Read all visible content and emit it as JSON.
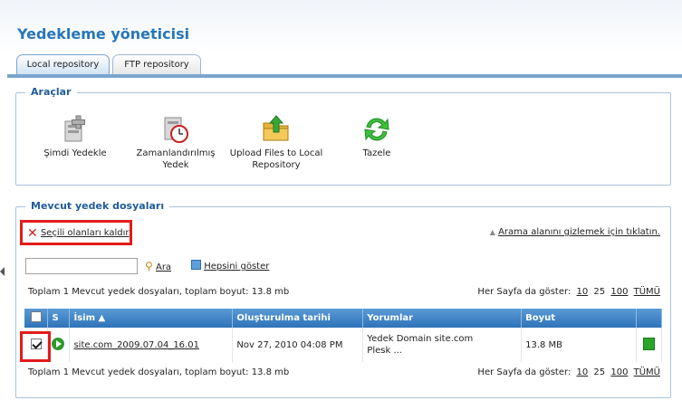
{
  "page": {
    "title": "Yedekleme yöneticisi"
  },
  "tabs": [
    {
      "label": "Local repository",
      "active": true
    },
    {
      "label": "FTP repository",
      "active": false
    }
  ],
  "tools": {
    "legend": "Araçlar",
    "items": [
      {
        "label": "Şimdi Yedekle",
        "icon": "backup-now-icon"
      },
      {
        "label": "Zamanlandırılmış Yedek",
        "icon": "scheduled-backup-icon"
      },
      {
        "label": "Upload Files to Local Repository",
        "icon": "upload-folder-icon"
      },
      {
        "label": "Tazele",
        "icon": "refresh-icon"
      }
    ]
  },
  "backups": {
    "legend": "Mevcut yedek dosyaları",
    "remove_selected": "Seçili olanları kaldır",
    "hide_search": "Arama alanını gizlemek için tıklatın.",
    "search": {
      "value": "",
      "placeholder": "",
      "search_label": "Ara",
      "show_all_label": "Hepsini göster"
    },
    "summary": "Toplam 1 Mevcut yedek dosyaları, toplam boyut: 13.8 mb",
    "per_page_label": "Her Sayfa da göster:",
    "per_page_options": [
      "10",
      "25",
      "100",
      "TÜMÜ"
    ],
    "columns": {
      "s": "S",
      "name": "İsim ▲",
      "created": "Oluşturulma tarihi",
      "comments": "Yorumlar",
      "size": "Boyut"
    },
    "rows": [
      {
        "checked": true,
        "name": "site.com_2009.07.04_16.01",
        "created": "Nov 27, 2010 04:08 PM",
        "comments_line1": "Yedek Domain site.com",
        "comments_line2": "Plesk ...",
        "size": "13.8 MB"
      }
    ]
  },
  "colors": {
    "accent": "#2776b8",
    "header": "#3a80c4",
    "highlight_red": "#e21b1b"
  }
}
